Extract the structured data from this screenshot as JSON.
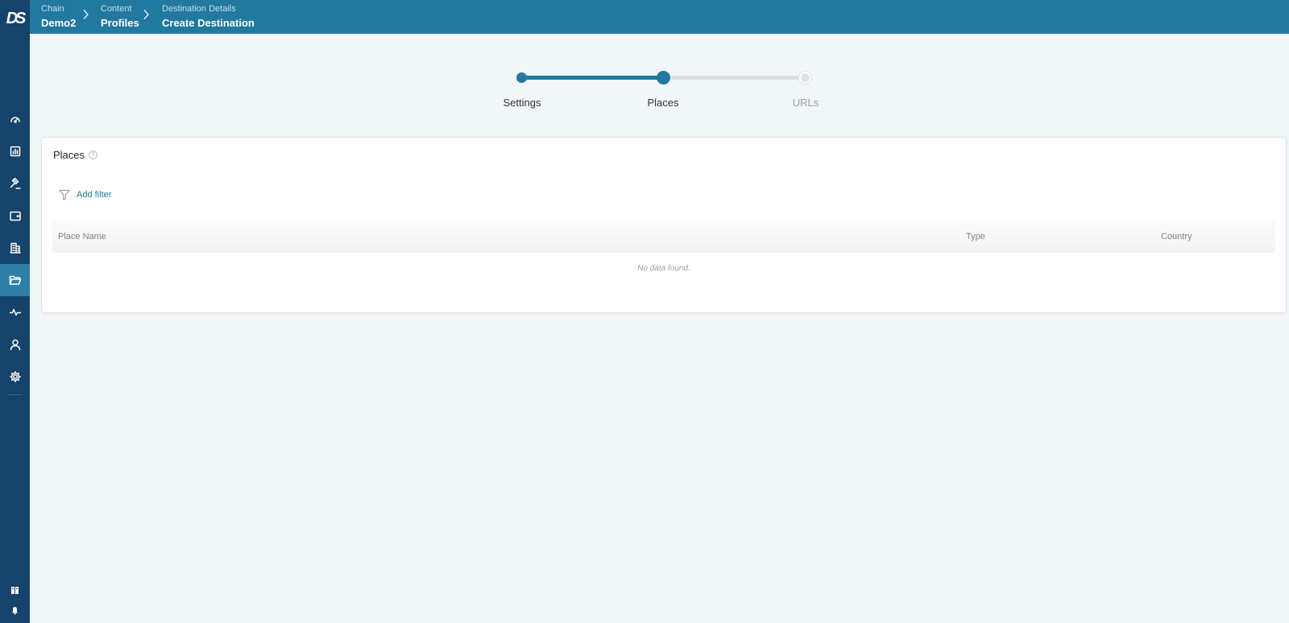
{
  "app": {
    "logo_text": "DS",
    "accent_color": "#21799f",
    "sidebar_color": "#16436b"
  },
  "breadcrumb": [
    {
      "small": "Chain",
      "big": "Demo2"
    },
    {
      "small": "Content",
      "big": "Profiles"
    },
    {
      "small": "Destination Details",
      "big": "Create Destination"
    }
  ],
  "sidebar": {
    "items": [
      {
        "icon": "dashboard-gauge-icon"
      },
      {
        "icon": "report-chart-icon"
      },
      {
        "icon": "gavel-icon"
      },
      {
        "icon": "wallet-icon"
      },
      {
        "icon": "building-icon"
      },
      {
        "icon": "folder-icon",
        "active": true
      },
      {
        "icon": "activity-pulse-icon"
      },
      {
        "icon": "user-icon"
      },
      {
        "icon": "settings-gear-icon"
      }
    ],
    "bottom": [
      {
        "icon": "book-icon"
      },
      {
        "icon": "bell-icon"
      }
    ]
  },
  "stepper": {
    "steps": [
      {
        "label": "Settings",
        "state": "done"
      },
      {
        "label": "Places",
        "state": "current"
      },
      {
        "label": "URLs",
        "state": "pending"
      }
    ]
  },
  "places": {
    "title": "Places",
    "help_glyph": "?",
    "add_filter_label": "Add filter",
    "columns": [
      "Place Name",
      "Type",
      "Country"
    ],
    "rows": [],
    "empty_text": "No data found."
  }
}
